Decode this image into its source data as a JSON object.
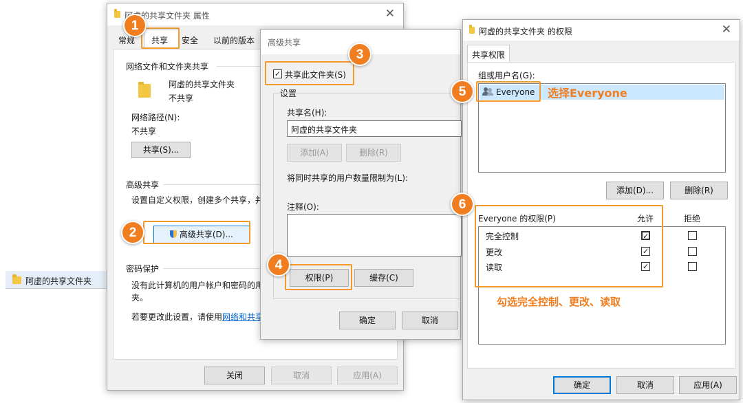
{
  "left_item": {
    "label": "阿虚的共享文件夹"
  },
  "props_window": {
    "title": "阿虚的共享文件夹 属性",
    "tabs": [
      "常规",
      "共享",
      "安全",
      "以前的版本"
    ],
    "net_section_title": "网络文件和文件夹共享",
    "folder_name": "阿虚的共享文件夹",
    "share_status": "不共享",
    "net_path_label": "网络路径(N):",
    "net_path_value": "不共享",
    "share_button": "共享(S)...",
    "adv_section_title": "高级共享",
    "adv_desc": "设置自定义权限，创建多个共享，并设",
    "adv_button": "高级共享(D)...",
    "pwd_section_title": "密码保护",
    "pwd_desc_1": "没有此计算机的用户帐户和密码的用户",
    "pwd_desc_2": "夹。",
    "pwd_change_prefix": "若要更改此设置，请使用",
    "pwd_change_link": "网络和共享中",
    "close_button": "关闭",
    "cancel_button": "取消",
    "apply_button": "应用(A)"
  },
  "adv_window": {
    "title": "高级共享",
    "share_checkbox": "共享此文件夹(S)",
    "settings_label": "设置",
    "share_name_label": "共享名(H):",
    "share_name_value": "阿虚的共享文件夹",
    "add_button": "添加(A)",
    "remove_button": "删除(R)",
    "limit_label": "将同时共享的用户数量限制为(L):",
    "comment_label": "注释(O):",
    "permissions_button": "权限(P)",
    "cache_button": "缓存(C)",
    "ok_button": "确定",
    "cancel_button": "取消"
  },
  "perm_window": {
    "title": "阿虚的共享文件夹 的权限",
    "tab": "共享权限",
    "group_label": "组或用户名(G):",
    "user": "Everyone",
    "add_button": "添加(D)...",
    "remove_button": "删除(R)",
    "perm_header": "Everyone 的权限(P)",
    "allow_header": "允许",
    "deny_header": "拒绝",
    "permissions": [
      {
        "name": "完全控制",
        "allow": true,
        "deny": false
      },
      {
        "name": "更改",
        "allow": true,
        "deny": false
      },
      {
        "name": "读取",
        "allow": true,
        "deny": false
      }
    ],
    "ok_button": "确定",
    "cancel_button": "取消",
    "apply_button": "应用(A)"
  },
  "annotations": {
    "steps": [
      "1",
      "2",
      "3",
      "4",
      "5",
      "6"
    ],
    "select_everyone": "选择Everyone",
    "check_hint": "勾选完全控制、更改、读取"
  },
  "colors": {
    "accent": "#f07d1f",
    "highlight": "#f39a2d",
    "selection": "#cce8ff",
    "link": "#0066cc"
  }
}
